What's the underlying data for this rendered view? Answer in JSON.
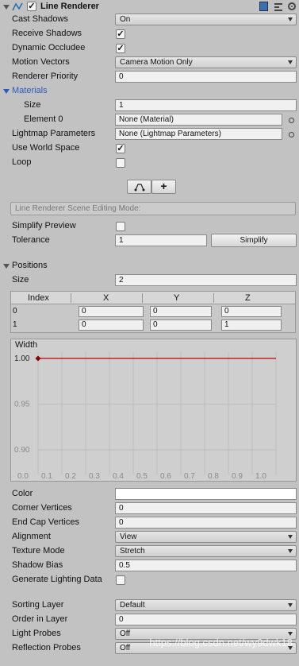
{
  "component": {
    "title": "Line Renderer",
    "enabled": true
  },
  "fields": {
    "cast_shadows": {
      "label": "Cast Shadows",
      "value": "On"
    },
    "receive_shadows": {
      "label": "Receive Shadows",
      "checked": true
    },
    "dynamic_occludee": {
      "label": "Dynamic Occludee",
      "checked": true
    },
    "motion_vectors": {
      "label": "Motion Vectors",
      "value": "Camera Motion Only"
    },
    "renderer_priority": {
      "label": "Renderer Priority",
      "value": "0"
    },
    "materials": {
      "label": "Materials"
    },
    "size": {
      "label": "Size",
      "value": "1"
    },
    "element0": {
      "label": "Element 0",
      "value": "None (Material)"
    },
    "lightmap_parameters": {
      "label": "Lightmap Parameters",
      "value": "None (Lightmap Parameters)"
    },
    "use_world_space": {
      "label": "Use World Space",
      "checked": true
    },
    "loop": {
      "label": "Loop",
      "checked": false
    }
  },
  "toolbar": {
    "edit_points_icon": "edit-points-icon",
    "add_point_label": "+"
  },
  "scene_editing_mode": "Line Renderer Scene Editing Mode:",
  "simplify_preview": {
    "label": "Simplify Preview",
    "checked": false
  },
  "tolerance": {
    "label": "Tolerance",
    "value": "1",
    "button": "Simplify"
  },
  "positions": {
    "label": "Positions",
    "size_label": "Size",
    "size_value": "2",
    "headers": [
      "Index",
      "X",
      "Y",
      "Z"
    ],
    "rows": [
      {
        "index": "0",
        "x": "0",
        "y": "0",
        "z": "0"
      },
      {
        "index": "1",
        "x": "0",
        "y": "0",
        "z": "1"
      }
    ]
  },
  "width_curve": {
    "label": "Width",
    "y_ticks": [
      "1.00",
      "0.95",
      "0.90"
    ],
    "x_ticks": [
      "0.0",
      "0.1",
      "0.2",
      "0.3",
      "0.4",
      "0.5",
      "0.6",
      "0.7",
      "0.8",
      "0.9",
      "1.0"
    ],
    "value": 1.0,
    "line_color": "#c00000"
  },
  "more": {
    "color": {
      "label": "Color",
      "value": "#ffffff"
    },
    "corner_vertices": {
      "label": "Corner Vertices",
      "value": "0"
    },
    "end_cap_vertices": {
      "label": "End Cap Vertices",
      "value": "0"
    },
    "alignment": {
      "label": "Alignment",
      "value": "View"
    },
    "texture_mode": {
      "label": "Texture Mode",
      "value": "Stretch"
    },
    "shadow_bias": {
      "label": "Shadow Bias",
      "value": "0.5"
    },
    "generate_lighting_data": {
      "label": "Generate Lighting Data",
      "checked": false
    },
    "sorting_layer": {
      "label": "Sorting Layer",
      "value": "Default"
    },
    "order_in_layer": {
      "label": "Order in Layer",
      "value": "0"
    },
    "light_probes": {
      "label": "Light Probes",
      "value": "Off"
    },
    "reflection_probes": {
      "label": "Reflection Probes",
      "value": "Off"
    }
  },
  "watermark": "https://blog.csdn.net/wy9dwk18"
}
